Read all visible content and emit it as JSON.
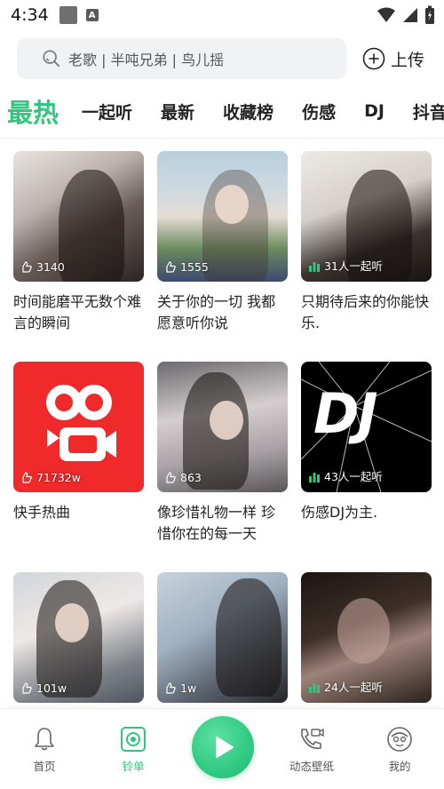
{
  "status_bar": {
    "time": "4:34",
    "notif_icon": "A"
  },
  "search": {
    "placeholder": "老歌 | 半吨兄弟 | 鸟儿摇"
  },
  "upload": {
    "label": "上传"
  },
  "tabs": [
    {
      "label": "最热",
      "active": true
    },
    {
      "label": "一起听"
    },
    {
      "label": "最新"
    },
    {
      "label": "收藏榜"
    },
    {
      "label": "伤感"
    },
    {
      "label": "DJ"
    },
    {
      "label": "抖音"
    }
  ],
  "playlists": [
    {
      "count": "3140",
      "count_icon": "like-icon",
      "title": "时间能磨平无数个难言的瞬间"
    },
    {
      "count": "1555",
      "count_icon": "like-icon",
      "title": "关于你的一切 我都愿意听你说"
    },
    {
      "count": "31人一起听",
      "count_icon": "equalizer-icon",
      "title": "只期待后来的你能快乐."
    },
    {
      "count": "71732w",
      "count_icon": "like-icon",
      "title": "快手热曲"
    },
    {
      "count": "863",
      "count_icon": "like-icon",
      "title": "像珍惜礼物一样 珍惜你在的每一天"
    },
    {
      "count": "43人一起听",
      "count_icon": "equalizer-icon",
      "title": "伤感DJ为主."
    },
    {
      "count": "101w",
      "count_icon": "like-icon",
      "title": ""
    },
    {
      "count": "1w",
      "count_icon": "like-icon",
      "title": ""
    },
    {
      "count": "24人一起听",
      "count_icon": "equalizer-icon",
      "title": ""
    }
  ],
  "dj_cover_text": "DJ",
  "bottom_nav": [
    {
      "label": "首页",
      "icon": "bell-icon",
      "active": false
    },
    {
      "label": "铃单",
      "icon": "playlist-icon",
      "active": true
    },
    {
      "label": "",
      "icon": "play-icon",
      "active": false
    },
    {
      "label": "动态壁纸",
      "icon": "video-call-icon",
      "active": false
    },
    {
      "label": "我的",
      "icon": "profile-icon",
      "active": false
    }
  ],
  "colors": {
    "accent": "#2fc77d",
    "kuaishou_red": "#f0292a"
  }
}
